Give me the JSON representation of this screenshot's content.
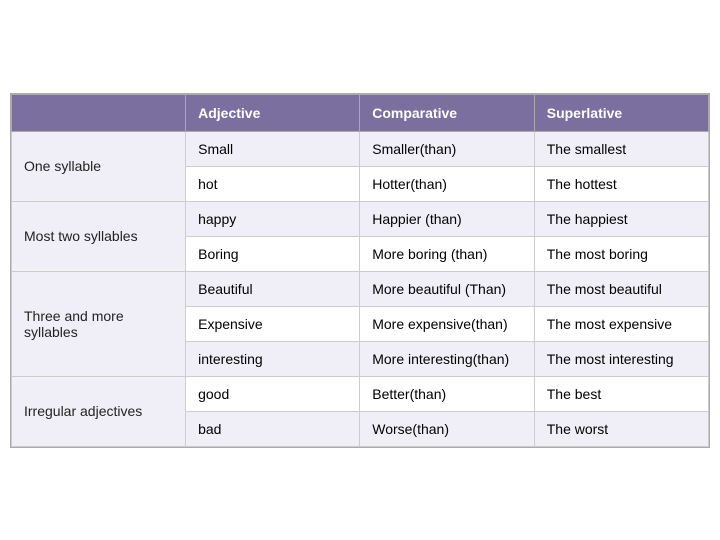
{
  "header": {
    "col0": "",
    "col1": "Adjective",
    "col2": "Comparative",
    "col3": "Superlative"
  },
  "rows": [
    {
      "category": "One syllable",
      "category_rowspan": 2,
      "adjective": "Small",
      "comparative": "Smaller(than)",
      "superlative": "The smallest",
      "shade": "light"
    },
    {
      "category": null,
      "adjective": "hot",
      "comparative": "Hotter(than)",
      "superlative": "The hottest",
      "shade": "white"
    },
    {
      "category": "Most  two syllables",
      "category_rowspan": 2,
      "adjective": "happy",
      "comparative": "Happier (than)",
      "superlative": "The happiest",
      "shade": "light"
    },
    {
      "category": null,
      "adjective": "Boring",
      "comparative": "More boring (than)",
      "superlative": "The most boring",
      "shade": "white"
    },
    {
      "category": "Three and more syllables",
      "category_rowspan": 3,
      "adjective": "Beautiful",
      "comparative": "More beautiful (Than)",
      "superlative": "The most beautiful",
      "shade": "light"
    },
    {
      "category": null,
      "adjective": "Expensive",
      "comparative": "More expensive(than)",
      "superlative": "The most expensive",
      "shade": "white"
    },
    {
      "category": null,
      "adjective": "interesting",
      "comparative": "More interesting(than)",
      "superlative": "The most interesting",
      "shade": "light"
    },
    {
      "category": "Irregular adjectives",
      "category_rowspan": 2,
      "adjective": "good",
      "comparative": "Better(than)",
      "superlative": "The best",
      "shade": "white"
    },
    {
      "category": null,
      "adjective": "bad",
      "comparative": "Worse(than)",
      "superlative": "The worst",
      "shade": "light"
    }
  ]
}
